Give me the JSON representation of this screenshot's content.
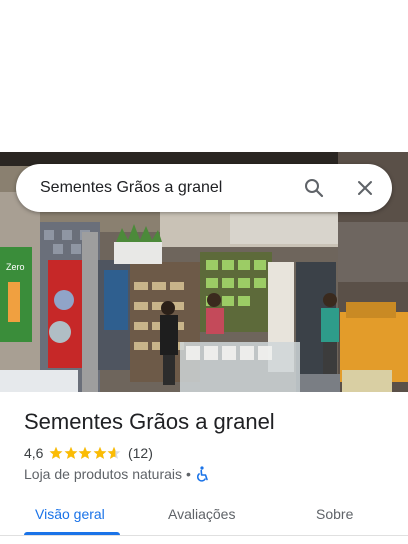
{
  "search": {
    "query": "Sementes Grãos a granel"
  },
  "place": {
    "name": "Sementes Grãos a granel",
    "rating": "4,6",
    "stars_filled": 4.6,
    "review_count": "(12)",
    "category": "Loja de produtos naturais",
    "separator": "•",
    "accessibility_icon": "wheelchair-icon"
  },
  "tabs": [
    {
      "label": "Visão geral",
      "active": true
    },
    {
      "label": "Avaliações",
      "active": false
    },
    {
      "label": "Sobre",
      "active": false
    }
  ],
  "colors": {
    "accent": "#1a73e8",
    "star": "#fbbc04",
    "text": "#202124",
    "muted": "#5f6368"
  },
  "photo": {
    "sign_text": "Zero"
  }
}
